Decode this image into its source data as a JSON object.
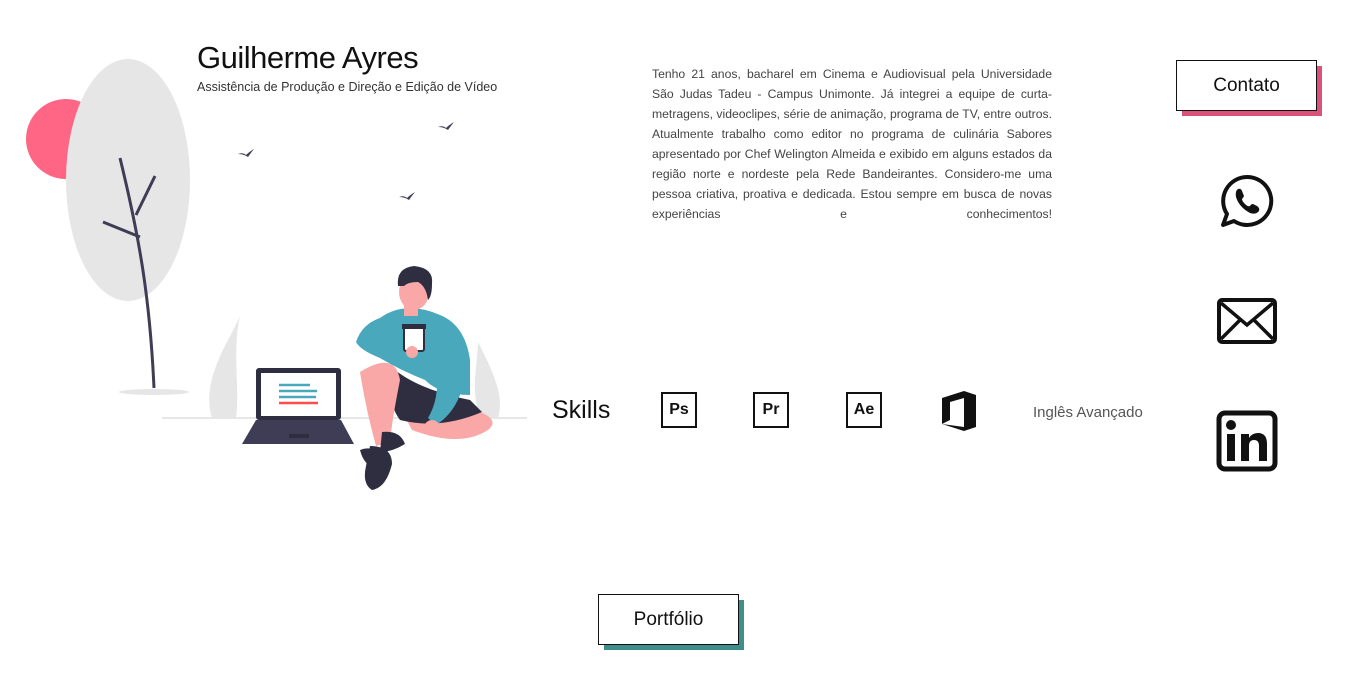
{
  "header": {
    "name": "Guilherme Ayres",
    "subtitle": "Assistência de Produção e Direção e Edição de Vídeo"
  },
  "bio": {
    "text": "Tenho 21 anos, bacharel em Cinema e Audiovisual pela Universidade São Judas Tadeu - Campus Unimonte. Já integrei a equipe de curta-metragens, videoclipes, série de animação, programa de TV, entre outros. Atualmente trabalho como editor no programa de culinária Sabores apresentado por Chef Welington Almeida e exibido em alguns estados da região norte e nordeste pela Rede Bandeirantes. Considero-me uma pessoa criativa, proativa e dedicada. Estou sempre em busca de novas experiências e conhecimentos!"
  },
  "contact": {
    "button_label": "Contato",
    "shadow_color": "#d9527a",
    "icons": [
      "whatsapp-icon",
      "email-icon",
      "linkedin-icon"
    ]
  },
  "skills": {
    "label": "Skills",
    "items": [
      {
        "name": "photoshop-icon",
        "abbr": "Ps"
      },
      {
        "name": "premiere-icon",
        "abbr": "Pr"
      },
      {
        "name": "after-effects-icon",
        "abbr": "Ae"
      },
      {
        "name": "office-icon",
        "abbr": ""
      }
    ],
    "language": "Inglês Avançado"
  },
  "portfolio": {
    "button_label": "Portfólio",
    "shadow_color": "#3e8f8a"
  },
  "colors": {
    "accent_pink": "#ff6584",
    "shirt_teal": "#4aa8bd",
    "skin": "#f9a7a7",
    "dark": "#2f2e41"
  }
}
